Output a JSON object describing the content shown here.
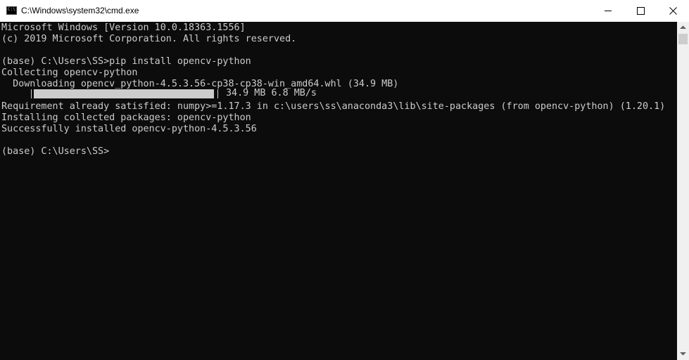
{
  "window": {
    "title": "C:\\Windows\\system32\\cmd.exe",
    "icon_label": "C:\\"
  },
  "console": {
    "lines": [
      "Microsoft Windows [Version 10.0.18363.1556]",
      "(c) 2019 Microsoft Corporation. All rights reserved.",
      "",
      "(base) C:\\Users\\SS>pip install opencv-python",
      "Collecting opencv-python",
      "  Downloading opencv_python-4.5.3.56-cp38-cp38-win_amd64.whl (34.9 MB)",
      "",
      "Requirement already satisfied: numpy>=1.17.3 in c:\\users\\ss\\anaconda3\\lib\\site-packages (from opencv-python) (1.20.1)",
      "Installing collected packages: opencv-python",
      "Successfully installed opencv-python-4.5.3.56",
      "",
      "(base) C:\\Users\\SS>"
    ],
    "progress": {
      "fraction": 1.0,
      "text": "34.9 MB 6.8 MB/s"
    }
  },
  "colors": {
    "console_background": "#0c0c0c",
    "console_text": "#cccccc",
    "titlebar_background": "#ffffff"
  },
  "icons": {
    "app": "cmd-console-icon",
    "minimize": "minimize-icon",
    "maximize": "maximize-icon",
    "close": "close-icon",
    "scroll_up": "arrow-up-icon",
    "scroll_down": "arrow-down-icon"
  }
}
